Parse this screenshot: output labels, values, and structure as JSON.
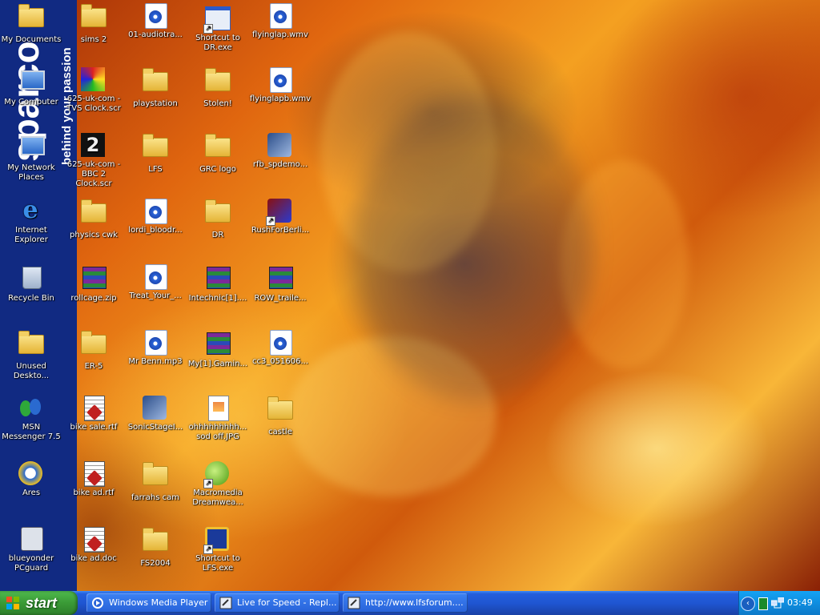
{
  "sidebar": {
    "brand_name": "sparco",
    "brand_slogan": "behind your passion",
    "icons": [
      {
        "label": "My Documents"
      },
      {
        "label": "My Computer"
      },
      {
        "label": "My Network Places"
      },
      {
        "label": "Internet Explorer"
      },
      {
        "label": "Recycle Bin"
      },
      {
        "label": "Unused Deskto..."
      },
      {
        "label": "MSN Messenger 7.5"
      },
      {
        "label": "Ares"
      },
      {
        "label": "blueyonder PCguard"
      }
    ]
  },
  "desktop": {
    "col1": [
      {
        "label": "sims 2"
      },
      {
        "label": "625-uk-com - TVS Clock.scr"
      },
      {
        "label": "625-uk-com - BBC 2 Clock.scr"
      },
      {
        "label": "physics cwk"
      },
      {
        "label": "rollcage.zip"
      },
      {
        "label": "ER-5"
      },
      {
        "label": "bike sale.rtf"
      },
      {
        "label": "bike ad.rtf"
      },
      {
        "label": "bike ad.doc"
      }
    ],
    "col2": [
      {
        "label": "01-audiotra..."
      },
      {
        "label": "playstation"
      },
      {
        "label": "LFS"
      },
      {
        "label": "lordi_bloodr..."
      },
      {
        "label": "Treat_Your_..."
      },
      {
        "label": "Mr Benn.mp3"
      },
      {
        "label": "SonicStageI..."
      },
      {
        "label": "farrahs cam"
      },
      {
        "label": "FS2004"
      }
    ],
    "col3": [
      {
        "label": "Shortcut to DR.exe"
      },
      {
        "label": "Stolen!"
      },
      {
        "label": "GRC logo"
      },
      {
        "label": "DR"
      },
      {
        "label": "Intechnic[1]...."
      },
      {
        "label": "My[1].Gamin..."
      },
      {
        "label": "ohhhhhhhhh... sod off.JPG"
      },
      {
        "label": "Macromedia Dreamwea..."
      },
      {
        "label": "Shortcut to LFS.exe"
      }
    ],
    "col4": [
      {
        "label": "flyinglap.wmv"
      },
      {
        "label": "flyinglapb.wmv"
      },
      {
        "label": "rfb_spdemo..."
      },
      {
        "label": "RushForBerli..."
      },
      {
        "label": "ROW_traile..."
      },
      {
        "label": "cc3_051606..."
      },
      {
        "label": "castle"
      }
    ]
  },
  "taskbar": {
    "start_label": "start",
    "tasks": [
      {
        "label": "Windows Media Player"
      },
      {
        "label": "Live for Speed - Repl..."
      },
      {
        "label": "http://www.lfsforum...."
      }
    ],
    "clock": "03:49",
    "tray_expand_glyph": "‹"
  },
  "colors": {
    "sidebar_bg": "#112a82",
    "taskbar_blue": "#245edb",
    "start_green": "#3a9a36",
    "tray_blue": "#0f8ee0"
  }
}
